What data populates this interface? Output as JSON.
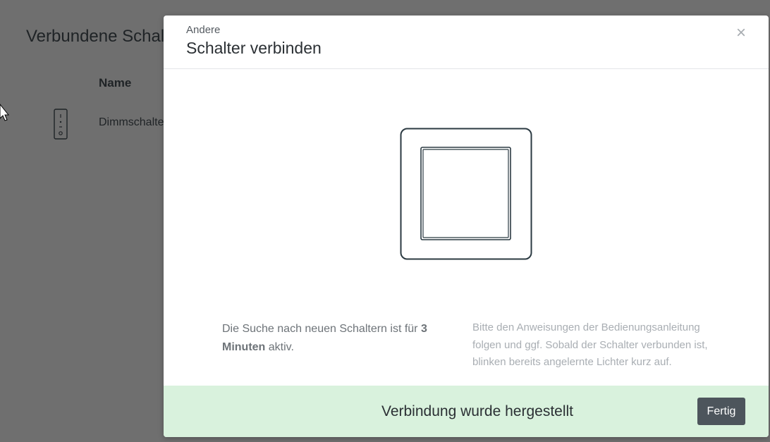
{
  "background": {
    "title": "Verbundene Schalter",
    "table": {
      "name_header": "Name",
      "rows": [
        {
          "label": "Dimmschalter",
          "icon": "dimmer-switch-icon"
        }
      ]
    }
  },
  "modal": {
    "subtitle": "Andere",
    "title": "Schalter verbinden",
    "close_label": "×",
    "illustration": "wall-switch-icon",
    "search_text_prefix": "Die Suche nach neuen Schaltern ist für",
    "search_duration": "3 Minuten",
    "search_text_suffix": "aktiv.",
    "instructions": "Bitte den Anweisungen der Bedienungsanleitung folgen und ggf. Sobald der Schalter verbunden ist, blinken bereits angelernte Lichter kurz auf.",
    "footer": {
      "status": "Verbindung wurde hergestellt",
      "done_label": "Fertig",
      "background_color": "#d9f2dd"
    }
  }
}
